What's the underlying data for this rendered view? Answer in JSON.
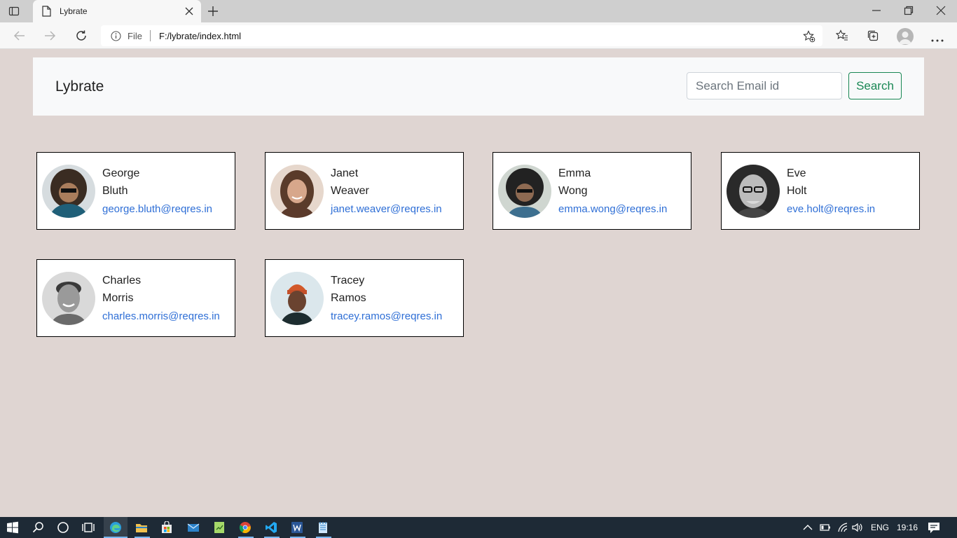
{
  "browser": {
    "tab_title": "Lybrate",
    "omnibox": {
      "scheme": "File",
      "url": "F:/lybrate/index.html"
    }
  },
  "page": {
    "brand": "Lybrate",
    "search": {
      "placeholder": "Search Email id",
      "value": "",
      "button_label": "Search"
    },
    "users": [
      {
        "first_name": "George",
        "last_name": "Bluth",
        "email": "george.bluth@reqres.in",
        "avatar_colors": [
          "#1f5f78",
          "#6b4f3c"
        ]
      },
      {
        "first_name": "Janet",
        "last_name": "Weaver",
        "email": "janet.weaver@reqres.in",
        "avatar_colors": [
          "#e6d7cc",
          "#6a4a38"
        ]
      },
      {
        "first_name": "Emma",
        "last_name": "Wong",
        "email": "emma.wong@reqres.in",
        "avatar_colors": [
          "#cfd6d0",
          "#2a2a2a"
        ]
      },
      {
        "first_name": "Eve",
        "last_name": "Holt",
        "email": "eve.holt@reqres.in",
        "avatar_colors": [
          "#2a2a2a",
          "#bcbcbc"
        ]
      },
      {
        "first_name": "Charles",
        "last_name": "Morris",
        "email": "charles.morris@reqres.in",
        "avatar_colors": [
          "#d9d9d9",
          "#6a6a6a"
        ]
      },
      {
        "first_name": "Tracey",
        "last_name": "Ramos",
        "email": "tracey.ramos@reqres.in",
        "avatar_colors": [
          "#dbe7ec",
          "#1d2d30"
        ]
      }
    ]
  },
  "taskbar": {
    "language": "ENG",
    "time": "19:16"
  },
  "colors": {
    "page_background": "#dfd5d2",
    "navbar_background": "#f8f9fa",
    "search_accent": "#198754",
    "link": "#2f6fd6"
  }
}
